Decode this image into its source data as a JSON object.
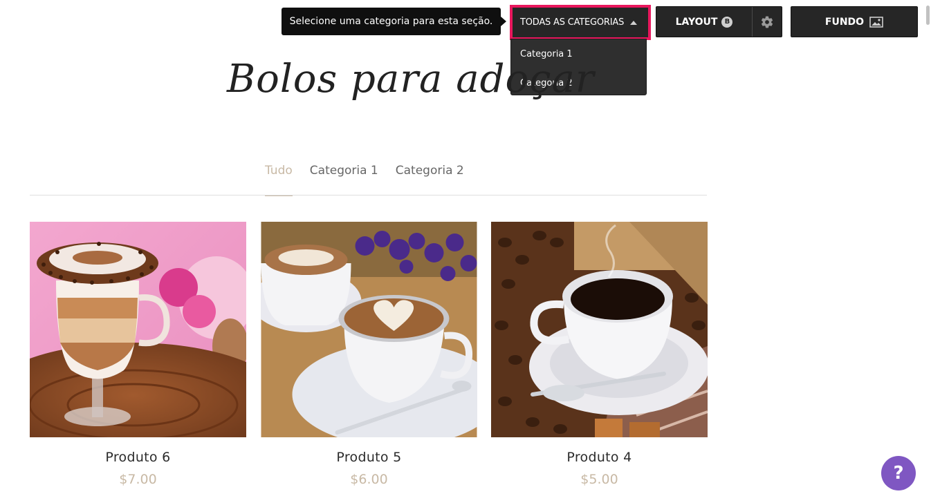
{
  "toolbar": {
    "tooltip": "Selecione uma categoria para esta seção.",
    "category_select": {
      "label": "TODAS AS CATEGORIAS",
      "options": [
        "Categoria 1",
        "Categoria 2"
      ]
    },
    "layout_label": "LAYOUT",
    "layout_badge": "B",
    "fundo_label": "FUNDO"
  },
  "section": {
    "title": "Bolos para adoçar",
    "tabs": [
      "Tudo",
      "Categoria 1",
      "Categoria 2"
    ],
    "active_tab": "Tudo"
  },
  "products": [
    {
      "name": "Produto 6",
      "price": "$7.00",
      "image": "layered-latte-glass-photo"
    },
    {
      "name": "Produto 5",
      "price": "$6.00",
      "image": "latte-art-cups-photo"
    },
    {
      "name": "Produto 4",
      "price": "$5.00",
      "image": "black-coffee-cup-beans-photo"
    }
  ],
  "help_label": "?",
  "colors": {
    "accent_highlight": "#e8175d",
    "toolbar_bg": "#262626",
    "active_tab": "#c8b9a5",
    "price": "#c8b9a5",
    "help_button": "#7f57c2"
  }
}
